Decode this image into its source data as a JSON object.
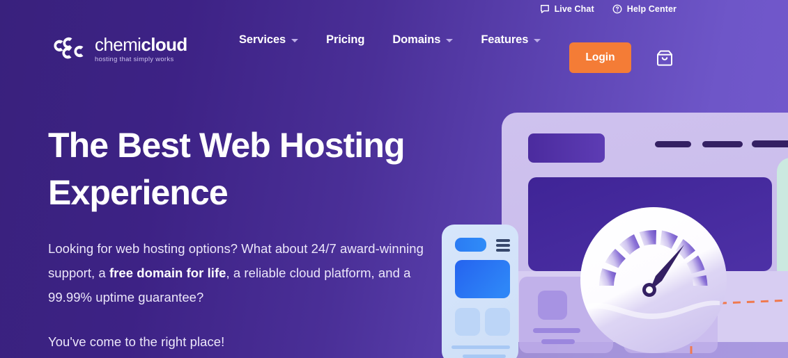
{
  "topbar": {
    "links": [
      {
        "label": "Live Chat",
        "icon": "chat-bubble-icon"
      },
      {
        "label": "Help Center",
        "icon": "question-circle-icon"
      }
    ]
  },
  "brand": {
    "name_light": "chemi",
    "name_bold": "cloud",
    "tagline": "hosting that simply works",
    "logo_icon": "chemicloud-logo-icon"
  },
  "nav": {
    "items": [
      {
        "label": "Services",
        "has_dropdown": true
      },
      {
        "label": "Pricing",
        "has_dropdown": false
      },
      {
        "label": "Domains",
        "has_dropdown": true
      },
      {
        "label": "Features",
        "has_dropdown": true
      }
    ],
    "login_label": "Login",
    "cart_icon": "shopping-bag-icon"
  },
  "hero": {
    "heading_line1": "The Best Web Hosting",
    "heading_line2": "Experience",
    "paragraph_part1": "Looking for web hosting options? What about 24/7 award-winning support, a ",
    "paragraph_bold": "free domain for life",
    "paragraph_part2": ", a reliable cloud platform, and a 99.99% uptime guarantee?",
    "closing_line": "You've come to the right place!"
  },
  "illustration": {
    "name": "hosting-dashboard-illustration",
    "elements": [
      "browser-window",
      "speedometer-gauge",
      "mobile-phone-mockup",
      "mint-panel",
      "orange-dashed-selection"
    ]
  },
  "colors": {
    "bg_left": "#39217d",
    "bg_right": "#7359cd",
    "accent_orange": "#f47c36",
    "text_white": "#ffffff",
    "text_muted": "#ece7fa",
    "caret": "#bdaee8",
    "mint": "#cbe9e0",
    "navy": "#342063",
    "blue": "#2b7df5"
  }
}
